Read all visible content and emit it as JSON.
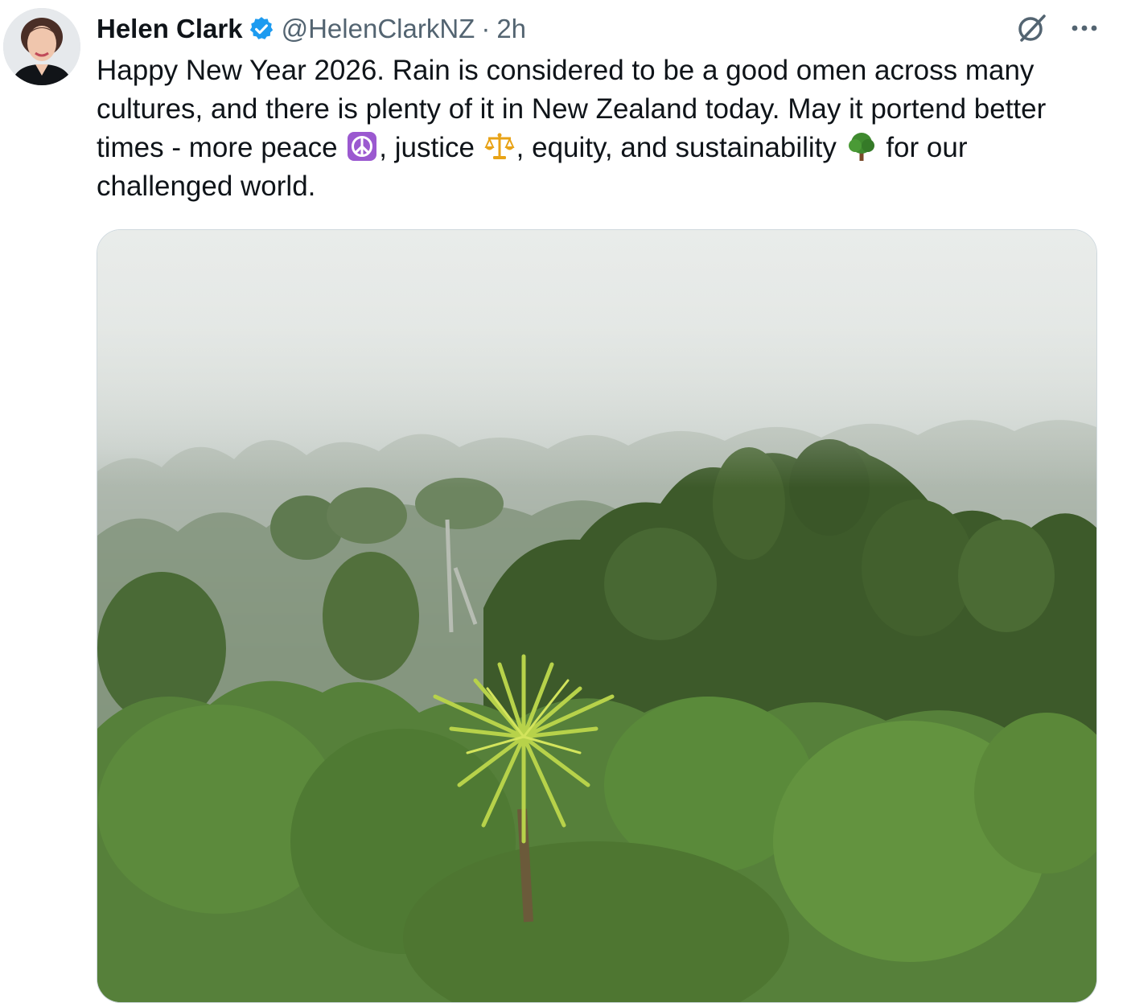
{
  "tweet": {
    "author_name": "Helen Clark",
    "handle": "@HelenClarkNZ",
    "separator": "·",
    "time": "2h",
    "text_parts": [
      "Happy New Year 2026. Rain is considered to be a good omen across many cultures, and there is plenty of it in New Zealand today. May it portend better times - more peace ",
      ", justice ",
      ", equity, and sustainability ",
      " for our challenged world."
    ],
    "emojis": [
      "peace-symbol",
      "balance-scale",
      "deciduous-tree"
    ],
    "more_label": "···"
  },
  "icons": {
    "verified": "verified-badge-icon",
    "grok": "grok-icon",
    "more": "more-icon"
  },
  "colors": {
    "verified_blue": "#1d9bf0",
    "text_primary": "#0f1419",
    "text_secondary": "#536471",
    "border": "#cfd9de",
    "peace_purple": "#9b59d0",
    "scale_gold": "#e8a317",
    "tree_green": "#3f8a2f"
  }
}
